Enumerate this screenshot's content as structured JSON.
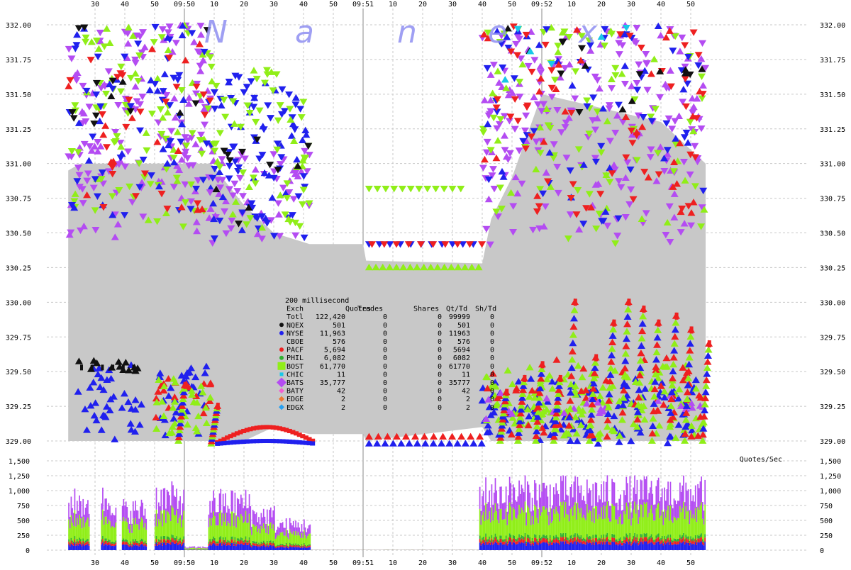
{
  "chart_data": {
    "type": "scatter",
    "watermark": [
      "N",
      "a",
      "n",
      "e",
      "x"
    ],
    "time_ticks": [
      {
        "t": -30,
        "label": "30"
      },
      {
        "t": -20,
        "label": "40"
      },
      {
        "t": -10,
        "label": "50"
      },
      {
        "t": 0,
        "label": "09:50"
      },
      {
        "t": 10,
        "label": "10"
      },
      {
        "t": 20,
        "label": "20"
      },
      {
        "t": 30,
        "label": "30"
      },
      {
        "t": 40,
        "label": "40"
      },
      {
        "t": 50,
        "label": "50"
      },
      {
        "t": 60,
        "label": "09:51"
      },
      {
        "t": 70,
        "label": "10"
      },
      {
        "t": 80,
        "label": "20"
      },
      {
        "t": 90,
        "label": "30"
      },
      {
        "t": 100,
        "label": "40"
      },
      {
        "t": 110,
        "label": "50"
      },
      {
        "t": 120,
        "label": "09:52"
      },
      {
        "t": 130,
        "label": "10"
      },
      {
        "t": 140,
        "label": "20"
      },
      {
        "t": 150,
        "label": "30"
      },
      {
        "t": 160,
        "label": "40"
      },
      {
        "t": 170,
        "label": "50"
      }
    ],
    "x_range_seconds_from_0950": [
      -39,
      175
    ],
    "price_axis": {
      "ylim": [
        328.95,
        332.05
      ],
      "ticks": [
        {
          "v": 329.0,
          "label": "329.00"
        },
        {
          "v": 329.25,
          "label": "329.25"
        },
        {
          "v": 329.5,
          "label": "329.50"
        },
        {
          "v": 329.75,
          "label": "329.75"
        },
        {
          "v": 330.0,
          "label": "330.00"
        },
        {
          "v": 330.25,
          "label": "330.25"
        },
        {
          "v": 330.5,
          "label": "330.50"
        },
        {
          "v": 330.75,
          "label": "330.75"
        },
        {
          "v": 331.0,
          "label": "331.00"
        },
        {
          "v": 331.25,
          "label": "331.25"
        },
        {
          "v": 331.5,
          "label": "331.50"
        },
        {
          "v": 331.75,
          "label": "331.75"
        },
        {
          "v": 332.0,
          "label": "332.00"
        }
      ]
    },
    "rate_axis": {
      "label": "Quotes/Sec",
      "ylim": [
        0,
        1500
      ],
      "ticks": [
        {
          "v": 0,
          "label": "0"
        },
        {
          "v": 250,
          "label": "250"
        },
        {
          "v": 500,
          "label": "500"
        },
        {
          "v": 750,
          "label": "750"
        },
        {
          "v": 1000,
          "label": "1,000"
        },
        {
          "v": 1250,
          "label": "1,250"
        },
        {
          "v": 1500,
          "label": "1,500"
        }
      ]
    },
    "spread_fill_color": "#c8c8c8",
    "spread_band": [
      {
        "t": -39,
        "bid": 329.0,
        "ask": 330.95
      },
      {
        "t": -35,
        "bid": 329.0,
        "ask": 331.0
      },
      {
        "t": -20,
        "bid": 329.0,
        "ask": 331.0
      },
      {
        "t": -10,
        "bid": 329.0,
        "ask": 331.0
      },
      {
        "t": 0,
        "bid": 329.0,
        "ask": 331.0
      },
      {
        "t": 9,
        "bid": 329.0,
        "ask": 331.0
      },
      {
        "t": 20,
        "bid": 329.0,
        "ask": 330.7
      },
      {
        "t": 30,
        "bid": 329.1,
        "ask": 330.5
      },
      {
        "t": 42,
        "bid": 329.05,
        "ask": 330.42
      },
      {
        "t": 60,
        "bid": 329.05,
        "ask": 330.42
      },
      {
        "t": 61,
        "bid": 329.0,
        "ask": 330.3
      },
      {
        "t": 100,
        "bid": 329.1,
        "ask": 330.28
      },
      {
        "t": 103,
        "bid": 329.0,
        "ask": 330.6
      },
      {
        "t": 110,
        "bid": 329.0,
        "ask": 330.9
      },
      {
        "t": 120,
        "bid": 329.0,
        "ask": 331.5
      },
      {
        "t": 140,
        "bid": 329.0,
        "ask": 331.4
      },
      {
        "t": 160,
        "bid": 329.0,
        "ask": 331.3
      },
      {
        "t": 175,
        "bid": 329.0,
        "ask": 331.0
      }
    ],
    "bursts": [
      {
        "t0": -39,
        "t1": -21,
        "color": "#b44cf2",
        "lo": 330.45,
        "hi": 331.95,
        "n": 60
      },
      {
        "t0": -20,
        "t1": -13,
        "color": "#b44cf2",
        "lo": 330.55,
        "hi": 332.0,
        "n": 30
      },
      {
        "t0": -9,
        "t1": 9,
        "color": "#b44cf2",
        "lo": 330.5,
        "hi": 332.0,
        "n": 70
      },
      {
        "t0": -39,
        "t1": 9,
        "color": "#90ee18",
        "lo": 330.5,
        "hi": 332.0,
        "n": 90
      },
      {
        "t0": -39,
        "t1": 9,
        "color": "#2020ee",
        "lo": 330.6,
        "hi": 332.0,
        "n": 70
      },
      {
        "t0": -39,
        "t1": 9,
        "color": "#ee2020",
        "lo": 330.6,
        "hi": 331.95,
        "n": 40
      },
      {
        "t0": 8,
        "t1": 42,
        "color": "#b44cf2",
        "lo": 330.4,
        "hi": 331.1,
        "n": 60
      },
      {
        "t0": 9,
        "t1": 42,
        "color": "#2020ee",
        "lo": 330.45,
        "hi": 331.65,
        "n": 90
      },
      {
        "t0": 9,
        "t1": 42,
        "color": "#90ee18",
        "lo": 330.45,
        "hi": 331.75,
        "n": 60
      },
      {
        "t0": 10,
        "t1": 42,
        "color": "#111111",
        "lo": 330.45,
        "hi": 331.2,
        "n": 12
      },
      {
        "t0": -39,
        "t1": 9,
        "color": "#111111",
        "lo": 331.0,
        "hi": 332.0,
        "n": 14
      },
      {
        "t0": 100,
        "t1": 175,
        "color": "#b44cf2",
        "lo": 330.4,
        "hi": 332.0,
        "n": 220
      },
      {
        "t0": 100,
        "t1": 175,
        "color": "#90ee18",
        "lo": 330.4,
        "hi": 332.0,
        "n": 90
      },
      {
        "t0": 100,
        "t1": 175,
        "color": "#2020ee",
        "lo": 330.5,
        "hi": 332.0,
        "n": 70
      },
      {
        "t0": 100,
        "t1": 175,
        "color": "#ee2020",
        "lo": 330.6,
        "hi": 332.0,
        "n": 80
      },
      {
        "t0": 100,
        "t1": 175,
        "color": "#111111",
        "lo": 331.2,
        "hi": 332.0,
        "n": 16
      },
      {
        "t0": 100,
        "t1": 175,
        "color": "#18c8e8",
        "lo": 331.5,
        "hi": 332.0,
        "n": 6
      },
      {
        "t0": -36,
        "t1": -14,
        "color": "#2020ee",
        "lo": 329.0,
        "hi": 329.55,
        "n": 40
      },
      {
        "t0": -36,
        "t1": -14,
        "color": "#111111",
        "lo": 329.5,
        "hi": 329.58,
        "n": 14
      },
      {
        "t0": -10,
        "t1": 9,
        "color": "#2020ee",
        "lo": 328.98,
        "hi": 329.55,
        "n": 30
      },
      {
        "t0": -10,
        "t1": 9,
        "color": "#ee2020",
        "lo": 329.1,
        "hi": 329.5,
        "n": 20
      },
      {
        "t0": -10,
        "t1": 9,
        "color": "#90ee18",
        "lo": 329.0,
        "hi": 329.45,
        "n": 30
      },
      {
        "t0": 100,
        "t1": 175,
        "color": "#2020ee",
        "lo": 328.97,
        "hi": 329.45,
        "n": 110
      },
      {
        "t0": 100,
        "t1": 175,
        "color": "#90ee18",
        "lo": 329.0,
        "hi": 329.55,
        "n": 130
      },
      {
        "t0": 100,
        "t1": 175,
        "color": "#ee2020",
        "lo": 329.0,
        "hi": 329.6,
        "n": 50
      },
      {
        "t0": 100,
        "t1": 175,
        "color": "#b44cf2",
        "lo": 329.15,
        "hi": 329.35,
        "n": 25
      }
    ],
    "ramps": [
      {
        "t": -2,
        "lo": 329.0,
        "hi": 329.4
      },
      {
        "t": 9,
        "lo": 328.98,
        "hi": 329.25
      },
      {
        "t": 106,
        "lo": 329.0,
        "hi": 329.35
      },
      {
        "t": 112,
        "lo": 329.0,
        "hi": 329.45
      },
      {
        "t": 118,
        "lo": 329.0,
        "hi": 329.55
      },
      {
        "t": 124,
        "lo": 329.0,
        "hi": 329.45
      },
      {
        "t": 129,
        "lo": 329.05,
        "hi": 330.0
      },
      {
        "t": 136,
        "lo": 329.0,
        "hi": 329.6
      },
      {
        "t": 142,
        "lo": 329.1,
        "hi": 329.85
      },
      {
        "t": 147,
        "lo": 329.15,
        "hi": 330.0
      },
      {
        "t": 152,
        "lo": 329.1,
        "hi": 329.95
      },
      {
        "t": 157,
        "lo": 329.0,
        "hi": 329.85
      },
      {
        "t": 163,
        "lo": 329.1,
        "hi": 329.9
      },
      {
        "t": 168,
        "lo": 329.0,
        "hi": 329.8
      },
      {
        "t": 174,
        "lo": 329.0,
        "hi": 329.7
      }
    ],
    "quiet_quotes": [
      {
        "t0": 62,
        "t1": 100,
        "color": "#90ee18",
        "price": 330.25,
        "step": 2.3
      },
      {
        "t0": 62,
        "t1": 100,
        "color": "#2020ee",
        "price": 330.42,
        "step": 3.5
      },
      {
        "t0": 63,
        "t1": 100,
        "color": "#ee2020",
        "price": 330.42,
        "step": 4.1
      },
      {
        "t0": 62,
        "t1": 95,
        "color": "#90ee18",
        "price": 330.82,
        "step": 2.8
      },
      {
        "t0": 62,
        "t1": 100,
        "color": "#2020ee",
        "price": 328.98,
        "step": 2.7
      },
      {
        "t0": 62,
        "t1": 100,
        "color": "#ee2020",
        "price": 329.03,
        "step": 3.1
      }
    ],
    "bid_rungs": [
      {
        "t0": 11,
        "t1": 44,
        "color": "#ee2020",
        "lo": 328.99,
        "hi": 329.1
      },
      {
        "t0": 11,
        "t1": 44,
        "color": "#2020ee",
        "lo": 328.98,
        "hi": 329.0
      }
    ],
    "rate_segments": [
      {
        "t0": -39,
        "t1": -32,
        "base": 950
      },
      {
        "t0": -32,
        "t1": -28,
        "base": 0
      },
      {
        "t0": -28,
        "t1": -23,
        "base": 1000
      },
      {
        "t0": -23,
        "t1": -21,
        "base": 0
      },
      {
        "t0": -21,
        "t1": -13,
        "base": 800
      },
      {
        "t0": -13,
        "t1": -10,
        "base": 0
      },
      {
        "t0": -10,
        "t1": 0,
        "base": 1050
      },
      {
        "t0": 0,
        "t1": 8,
        "base": 60
      },
      {
        "t0": 8,
        "t1": 22,
        "base": 950
      },
      {
        "t0": 22,
        "t1": 30,
        "base": 700
      },
      {
        "t0": 30,
        "t1": 42,
        "base": 500
      },
      {
        "t0": 42,
        "t1": 99,
        "base": 8
      },
      {
        "t0": 99,
        "t1": 175,
        "base": 1150
      }
    ],
    "legend": {
      "title": "200 millisecond",
      "columns": [
        "Exch",
        "Quotes",
        "Trades",
        "Shares",
        "Qt/Td",
        "Sh/Td"
      ],
      "rows": [
        {
          "exch": "Totl",
          "quotes": "122,420",
          "trades": "0",
          "shares": "0",
          "qt_td": "99999",
          "sh_td": "0",
          "color": "",
          "marker": "none"
        },
        {
          "exch": "NQEX",
          "quotes": "501",
          "trades": "0",
          "shares": "0",
          "qt_td": "501",
          "sh_td": "0",
          "color": "#111111",
          "marker": "circle"
        },
        {
          "exch": "NYSE",
          "quotes": "11,963",
          "trades": "0",
          "shares": "0",
          "qt_td": "11963",
          "sh_td": "0",
          "color": "#2020ee",
          "marker": "circle"
        },
        {
          "exch": "CBOE",
          "quotes": "576",
          "trades": "0",
          "shares": "0",
          "qt_td": "576",
          "sh_td": "0",
          "color": "#c8c8c8",
          "marker": "circle"
        },
        {
          "exch": "PACF",
          "quotes": "5,694",
          "trades": "0",
          "shares": "0",
          "qt_td": "5694",
          "sh_td": "0",
          "color": "#ee2020",
          "marker": "circle"
        },
        {
          "exch": "PHIL",
          "quotes": "6,082",
          "trades": "0",
          "shares": "0",
          "qt_td": "6082",
          "sh_td": "0",
          "color": "#30b030",
          "marker": "circle"
        },
        {
          "exch": "BOST",
          "quotes": "61,770",
          "trades": "0",
          "shares": "0",
          "qt_td": "61770",
          "sh_td": "0",
          "color": "#90ee18",
          "marker": "square"
        },
        {
          "exch": "CHIC",
          "quotes": "11",
          "trades": "0",
          "shares": "0",
          "qt_td": "11",
          "sh_td": "0",
          "color": "#18c8e8",
          "marker": "square"
        },
        {
          "exch": "BATS",
          "quotes": "35,777",
          "trades": "0",
          "shares": "0",
          "qt_td": "35777",
          "sh_td": "0",
          "color": "#b44cf2",
          "marker": "diamond"
        },
        {
          "exch": "BATY",
          "quotes": "42",
          "trades": "0",
          "shares": "0",
          "qt_td": "42",
          "sh_td": "0",
          "color": "#f060d0",
          "marker": "diamond"
        },
        {
          "exch": "EDGE",
          "quotes": "2",
          "trades": "0",
          "shares": "0",
          "qt_td": "2",
          "sh_td": "0",
          "color": "#f07830",
          "marker": "diamond"
        },
        {
          "exch": "EDGX",
          "quotes": "2",
          "trades": "0",
          "shares": "0",
          "qt_td": "2",
          "sh_td": "0",
          "color": "#28a0f0",
          "marker": "diamond"
        }
      ]
    },
    "grid": true
  }
}
